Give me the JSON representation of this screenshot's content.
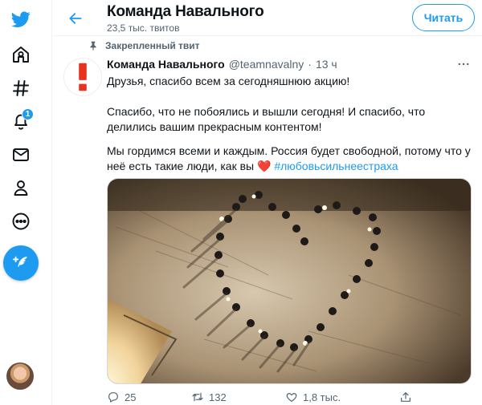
{
  "colors": {
    "accent": "#1d9bf0",
    "text": "#0f1419",
    "secondary": "#536471",
    "heart": "#e0245e",
    "logo_red": "#e8321e"
  },
  "nav": {
    "items": [
      {
        "icon": "twitter-bird-icon"
      },
      {
        "icon": "home-icon"
      },
      {
        "icon": "hashtag-explore-icon"
      },
      {
        "icon": "bell-notifications-icon",
        "badge": "1"
      },
      {
        "icon": "envelope-messages-icon"
      },
      {
        "icon": "person-profile-icon"
      },
      {
        "icon": "more-circle-icon"
      }
    ],
    "compose_icon": "feather-compose-icon"
  },
  "header": {
    "name": "Команда Навального",
    "tweet_count": "23,5 тыс. твитов",
    "follow_label": "Читать"
  },
  "pinned_label": "Закрепленный твит",
  "tweet": {
    "author_name": "Команда Навального",
    "handle": "@teamnavalny",
    "separator": "·",
    "time": "13 ч",
    "paragraph1": "Друзья, спасибо всем за сегодняшнюю акцию!",
    "paragraph2": "Спасибо, что не побоялись и вышли сегодня! И спасибо, что делились вашим прекрасным контентом!",
    "paragraph3": "Мы гордимся всеми и каждым. Россия будет свободной, потому что у неё есть такие люди, как вы",
    "heart_emoji": "❤️",
    "hashtag": "#любовьсильнеестраха",
    "media_icon": "photo-people-heart-snow",
    "stats": {
      "replies": "25",
      "retweets": "132",
      "likes": "1,8 тыс."
    }
  }
}
